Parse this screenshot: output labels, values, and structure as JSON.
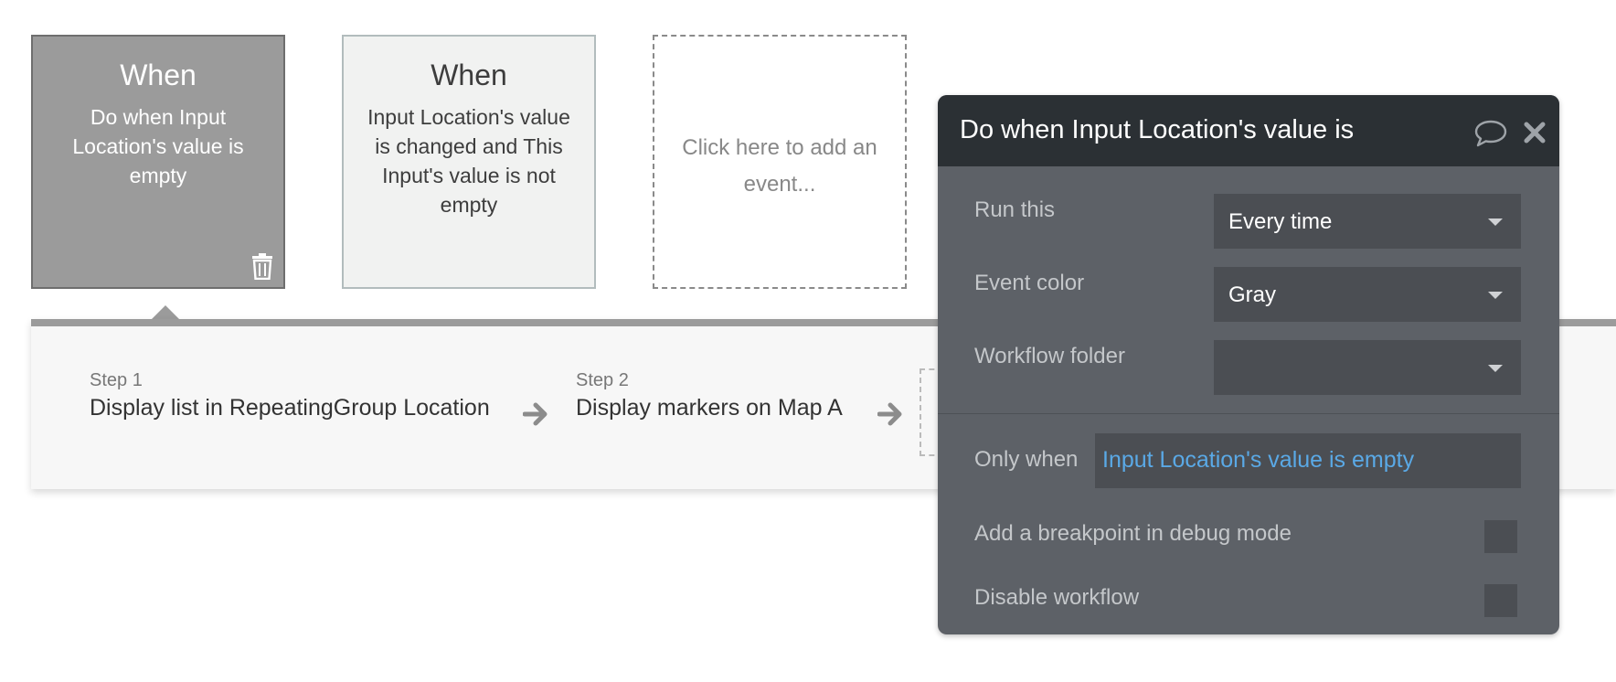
{
  "events": [
    {
      "when": "When",
      "description": "Do when Input Location's value is empty"
    },
    {
      "when": "When",
      "description": "Input Location's value is changed and This Input's value is not empty"
    },
    {
      "add_text": "Click here to add an event..."
    }
  ],
  "steps": [
    {
      "label": "Step 1",
      "title": "Display list in RepeatingGroup Location"
    },
    {
      "label": "Step 2",
      "title": "Display markers on Map A"
    }
  ],
  "panel": {
    "title": "Do when Input Location's value is",
    "run_this": {
      "label": "Run this",
      "value": "Every time"
    },
    "event_color": {
      "label": "Event color",
      "value": "Gray"
    },
    "workflow_folder": {
      "label": "Workflow folder",
      "value": ""
    },
    "only_when": {
      "label": "Only when",
      "value": "Input Location's value is empty"
    },
    "breakpoint": {
      "label": "Add a breakpoint in debug mode",
      "checked": false
    },
    "disable": {
      "label": "Disable workflow",
      "checked": false
    }
  },
  "icons": {
    "trash": "trash-icon",
    "arrow": "arrow-right-icon",
    "comment": "comment-icon",
    "close": "close-icon",
    "caret": "caret-down-icon"
  },
  "colors": {
    "selected_event_bg": "#9b9b9b",
    "panel_bg": "#5d6167",
    "panel_header_bg": "#2b3034",
    "expression_text": "#5aa9e6"
  }
}
